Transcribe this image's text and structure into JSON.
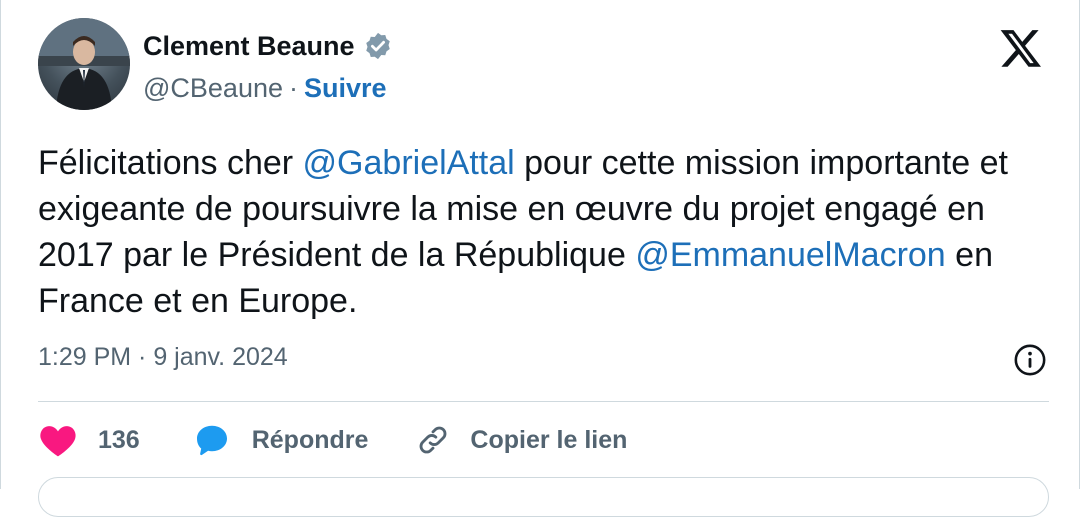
{
  "author": {
    "display_name": "Clement Beaune",
    "handle": "@CBeaune",
    "separator": "·",
    "follow_label": "Suivre"
  },
  "tweet": {
    "text_1": "Félicitations cher ",
    "mention_1": "@GabrielAttal",
    "text_2": " pour cette mission importante et exigeante de poursuivre la mise en œuvre du projet engagé en 2017 par le Président de la République ",
    "mention_2": "@EmmanuelMacron",
    "text_3": " en France et en Europe.",
    "timestamp": "1:29 PM · 9 janv. 2024"
  },
  "actions": {
    "like_count": "136",
    "reply_label": "Répondre",
    "copy_link_label": "Copier le lien"
  },
  "icons": [
    "avatar",
    "verified-badge-icon",
    "x-logo-icon",
    "info-icon",
    "heart-icon",
    "reply-bubble-icon",
    "link-icon"
  ],
  "colors": {
    "link_blue": "#1d6fb8",
    "like_pink": "#f91880",
    "reply_blue": "#1d9bf0",
    "muted_gray": "#536471",
    "text_black": "#0f1419"
  }
}
